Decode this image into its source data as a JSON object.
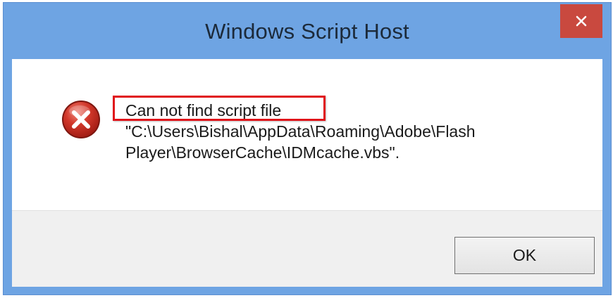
{
  "window": {
    "title": "Windows Script Host",
    "close_glyph": "✕",
    "accent_color": "#6ea4e3",
    "close_color": "#c9493f"
  },
  "dialog": {
    "icon": "error-icon",
    "headline": "Can not find script file",
    "path_line_1": "\"C:\\Users\\Bishal\\AppData\\Roaming\\Adobe\\Flash",
    "path_line_2": "Player\\BrowserCache\\IDMcache.vbs\".",
    "highlight_color": "#e0141a"
  },
  "buttons": {
    "ok_label": "OK"
  }
}
